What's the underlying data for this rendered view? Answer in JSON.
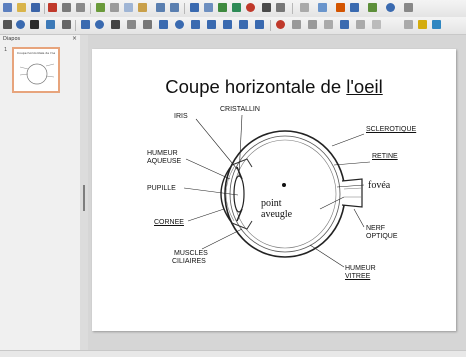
{
  "slides_pane": {
    "title": "Diapos",
    "close": "×",
    "thumbnails": [
      {
        "number": "1",
        "title": "Coupe horizontale de l'oeil"
      }
    ]
  },
  "slide": {
    "title_main": "Coupe horizontale de ",
    "title_underlined": "l'oeil",
    "labels": {
      "cristallin": "CRISTALLIN",
      "iris": "IRIS",
      "sclerotique": "SCLEROTIQUE",
      "humeur_aqueuse_1": "HUMEUR",
      "humeur_aqueuse_2": "AQUEUSE",
      "retine": "RETINE",
      "pupille": "PUPILLE",
      "fovea": "fovéa",
      "point_aveugle_1": "point",
      "point_aveugle_2": "aveugle",
      "cornee": "CORNEE",
      "nerf_1": "NERF",
      "nerf_2": "OPTIQUE",
      "muscles_1": "MUSCLES",
      "muscles_2": "CILIAIRES",
      "humeur_vitree_1": "HUMEUR",
      "humeur_vitree_2": "VITREE"
    }
  },
  "colors": {
    "thumb_border": "#e7a47c",
    "slide_bg": "#ffffff",
    "workspace_bg": "#d6d6d6"
  }
}
